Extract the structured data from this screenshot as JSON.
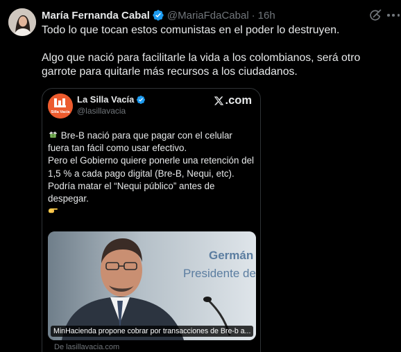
{
  "author": {
    "name": "María Fernanda Cabal",
    "handle": "@MariaFdaCabal",
    "separator": "·",
    "time": "16h",
    "verified_color": "#1d9bf0"
  },
  "tweet": {
    "paragraph1": "Todo lo que tocan estos comunistas en el poder lo destruyen.",
    "paragraph2": "Algo que nació para facilitarle la vida a los colombianos, será otro garrote para quitarle más recursos a los ciudadanos."
  },
  "icons": {
    "grok": "grok-icon",
    "more": "more-dots-icon",
    "verified": "verified-badge-icon"
  },
  "quote": {
    "name": "La Silla Vacía",
    "handle": "@lasillavacia",
    "avatar_text": "Silla Vacía",
    "source_logo": ".com",
    "line1": "Bre-B nació para que pagar con el celular fuera tan fácil como usar efectivo.",
    "line2": "Pero el Gobierno quiere ponerle una retención del 1,5 % a cada pago digital (Bre-B, Nequi, etc). Podría matar el “Nequi público” antes de despegar.",
    "emoji1": "money-with-wings-icon",
    "emoji2": "pointing-right-hand-icon",
    "image": {
      "bg_text_name": "Germán A",
      "bg_text_title": "Presidente del Grupo",
      "caption": "MinHacienda propone cobrar por transacciones de Bre-b a..."
    },
    "link": "De lasillavacia.com"
  },
  "colors": {
    "background": "#000000",
    "text": "#e7e9ea",
    "muted": "#71767b",
    "border": "#2f3336",
    "brand_orange": "#ec5b2e"
  }
}
